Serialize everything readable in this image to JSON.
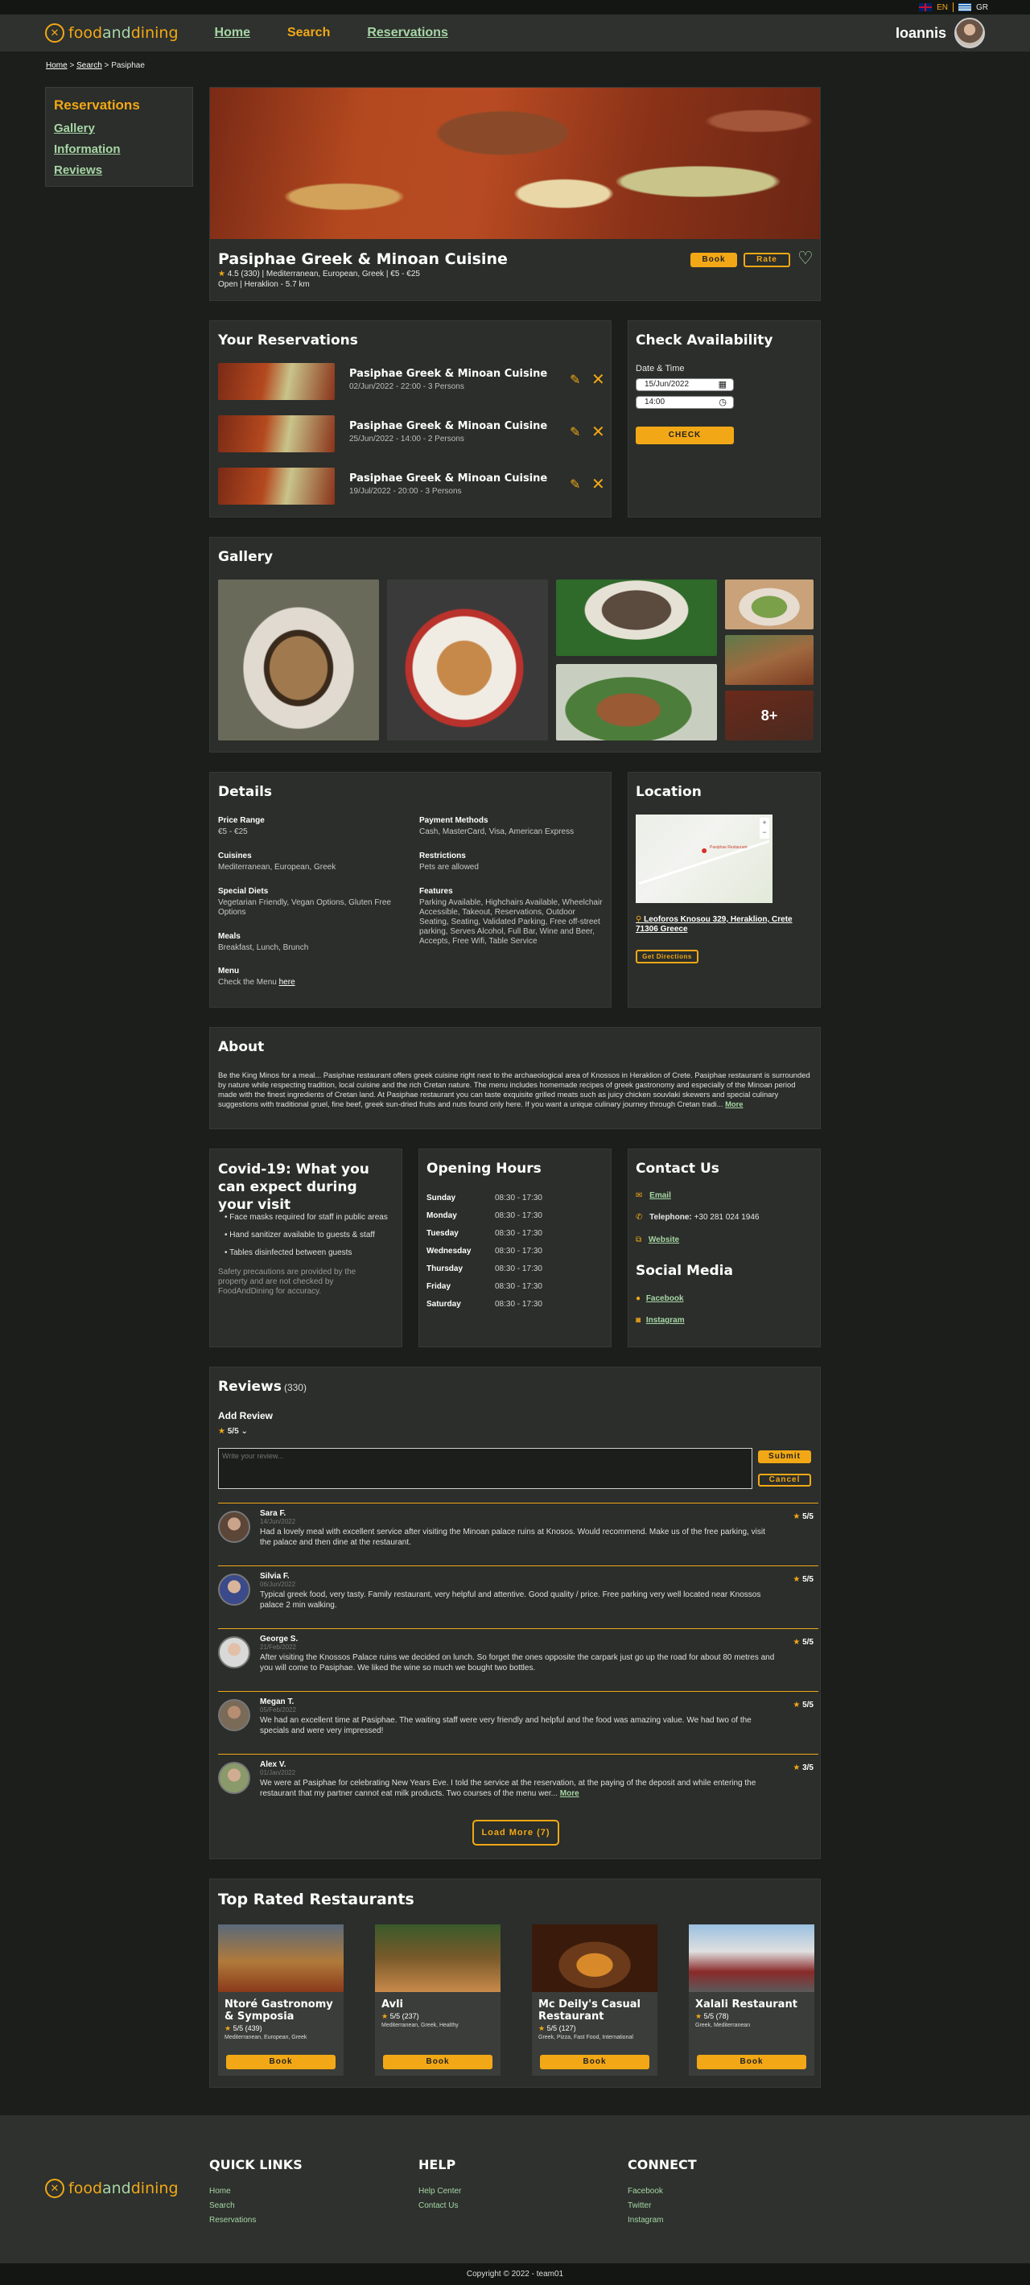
{
  "lang": {
    "en": "EN",
    "gr": "GR"
  },
  "header": {
    "logo": [
      "food",
      "and",
      "dining"
    ],
    "nav": [
      "Home",
      "Search",
      "Reservations"
    ],
    "user": "Ioannis"
  },
  "breadcrumb": {
    "home": "Home",
    "search": "Search",
    "current": "Pasiphae"
  },
  "sidebar": {
    "title": "Reservations",
    "items": [
      "Gallery",
      "Information",
      "Reviews"
    ]
  },
  "restaurant": {
    "name": "Pasiphae Greek & Minoan Cuisine",
    "rating": "4.5 (330) | Mediterranean, European, Greek | €5 - €25",
    "status": "Open | Heraklion - 5.7 km",
    "book": "Book",
    "rate": "Rate"
  },
  "reservations": {
    "title": "Your Reservations",
    "items": [
      {
        "name": "Pasiphae Greek & Minoan Cuisine",
        "details": "02/Jun/2022 - 22:00 - 3 Persons"
      },
      {
        "name": "Pasiphae Greek & Minoan Cuisine",
        "details": "25/Jun/2022 - 14:00 - 2 Persons"
      },
      {
        "name": "Pasiphae Greek & Minoan Cuisine",
        "details": "19/Jul/2022 - 20:00 - 3 Persons"
      }
    ]
  },
  "availability": {
    "title": "Check Availability",
    "label": "Date & Time",
    "date": "15/Jun/2022",
    "time": "14:00",
    "button": "CHECK"
  },
  "gallery": {
    "title": "Gallery",
    "more": "8+"
  },
  "details": {
    "title": "Details",
    "price_label": "Price Range",
    "price": "€5 - €25",
    "cuisines_label": "Cuisines",
    "cuisines": "Mediterranean, European, Greek",
    "diets_label": "Special Diets",
    "diets": "Vegetarian Friendly, Vegan Options, Gluten Free Options",
    "meals_label": "Meals",
    "meals": "Breakfast, Lunch, Brunch",
    "menu_label": "Menu",
    "menu_text": "Check the Menu ",
    "menu_link": "here",
    "payment_label": "Payment Methods",
    "payment": "Cash, MasterCard, Visa, American Express",
    "restrictions_label": "Restrictions",
    "restrictions": "Pets are allowed",
    "features_label": "Features",
    "features": "Parking Available, Highchairs Available, Wheelchair Accessible, Takeout, Reservations, Outdoor Seating, Seating, Validated Parking, Free off-street parking, Serves Alcohol, Full Bar, Wine and Beer, Accepts, Free Wifi, Table Service"
  },
  "location": {
    "title": "Location",
    "address": "Leoforos Knosou 329, Heraklion, Crete 71306 Greece",
    "directions": "Get Directions",
    "map_pin": "Pasiphae Restaurant"
  },
  "about": {
    "title": "About",
    "text": "Be the King Minos for a meal... Pasiphae restaurant offers greek cuisine right next to the archaeological area of Knossos in Heraklion of Crete. Pasiphae restaurant is surrounded by nature while respecting tradition, local cuisine and the rich Cretan nature. The menu includes homemade recipes of greek gastronomy and especially of the Minoan period made with the finest ingredients of Cretan land. At Pasiphae restaurant you can taste exquisite grilled meats such as juicy chicken souvlaki skewers and special culinary suggestions with traditional gruel, fine beef, greek sun-dried fruits and nuts found only here. If you want a unique culinary journey through Cretan tradi...",
    "more": "More"
  },
  "covid": {
    "title": "Covid-19: What you can expect during your visit",
    "items": [
      "Face masks required for staff in public areas",
      "Hand sanitizer available to guests & staff",
      "Tables disinfected between guests"
    ],
    "note": "Safety precautions are provided by the property and are not checked by FoodAndDining for accuracy."
  },
  "hours": {
    "title": "Opening Hours",
    "rows": [
      {
        "day": "Sunday",
        "time": "08:30 - 17:30"
      },
      {
        "day": "Monday",
        "time": "08:30 - 17:30"
      },
      {
        "day": "Tuesday",
        "time": "08:30 - 17:30"
      },
      {
        "day": "Wednesday",
        "time": "08:30 - 17:30"
      },
      {
        "day": "Thursday",
        "time": "08:30 - 17:30"
      },
      {
        "day": "Friday",
        "time": "08:30 - 17:30"
      },
      {
        "day": "Saturday",
        "time": "08:30 - 17:30"
      }
    ]
  },
  "contact": {
    "title": "Contact Us",
    "email": "Email",
    "phone_label": "Telephone:",
    "phone": "+30 281 024 1946",
    "website": "Website"
  },
  "social": {
    "title": "Social Media",
    "facebook": "Facebook",
    "instagram": "Instagram"
  },
  "reviews": {
    "title": "Reviews",
    "count": "(330)",
    "add_title": "Add Review",
    "add_rating": "5/5",
    "placeholder": "Write your review...",
    "submit": "Submit",
    "cancel": "Cancel",
    "load_more": "Load More (7)",
    "items": [
      {
        "name": "Sara F.",
        "date": "14/Jun/2022",
        "rating": "5/5",
        "text": "Had a lovely meal with excellent service after visiting the Minoan palace ruins at Knosos. Would recommend. Make us of the free parking, visit the palace and then dine at the restaurant.",
        "more": ""
      },
      {
        "name": "Silvia F.",
        "date": "06/Jun/2022",
        "rating": "5/5",
        "text": "Typical greek food, very tasty. Family restaurant, very helpful and attentive. Good quality / price. Free parking very well located near Knossos palace 2 min walking.",
        "more": ""
      },
      {
        "name": "George S.",
        "date": "21/Feb/2022",
        "rating": "5/5",
        "text": "After visiting the Knossos Palace ruins we decided on lunch. So forget the ones opposite the carpark just go up the road for about 80 metres and you will come to Pasiphae. We liked the wine so much we bought two bottles.",
        "more": ""
      },
      {
        "name": "Megan T.",
        "date": "05/Feb/2022",
        "rating": "5/5",
        "text": "We had an excellent time at Pasiphae. The waiting staff were very friendly and helpful and the food was amazing value. We had two of the specials and were very impressed!",
        "more": ""
      },
      {
        "name": "Alex V.",
        "date": "01/Jan/2022",
        "rating": "3/5",
        "text": "We were at Pasiphae for celebrating New Years Eve. I told the service at the reservation, at the paying of the deposit and while entering the restaurant that my partner cannot eat milk products. Two courses of the menu wer... ",
        "more": "More"
      }
    ]
  },
  "top_rated": {
    "title": "Top Rated Restaurants",
    "items": [
      {
        "name": "Ntoré Gastronomy & Symposia",
        "rating": "5/5 (439)",
        "cuisine": "Mediterranean, European, Greek",
        "book": "Book"
      },
      {
        "name": "Avli",
        "rating": "5/5 (237)",
        "cuisine": "Mediterranean, Greek, Healthy",
        "book": "Book"
      },
      {
        "name": "Mc Deily's Casual Restaurant",
        "rating": "5/5 (127)",
        "cuisine": "Greek, Pizza, Fast Food, International",
        "book": "Book"
      },
      {
        "name": "Xalali Restaurant",
        "rating": "5/5 (78)",
        "cuisine": "Greek, Mediterranean",
        "book": "Book"
      }
    ]
  },
  "footer": {
    "quick_title": "QUICK LINKS",
    "quick": [
      "Home",
      "Search",
      "Reservations"
    ],
    "help_title": "HELP",
    "help": [
      "Help Center",
      "Contact Us"
    ],
    "connect_title": "CONNECT",
    "connect": [
      "Facebook",
      "Twitter",
      "Instagram"
    ],
    "copyright": "Copyright © 2022 - team01"
  },
  "colors": {
    "accent": "#f2a816",
    "link": "#a7d6a5",
    "panel": "#2b2e2b",
    "background": "#1b1e1b"
  }
}
